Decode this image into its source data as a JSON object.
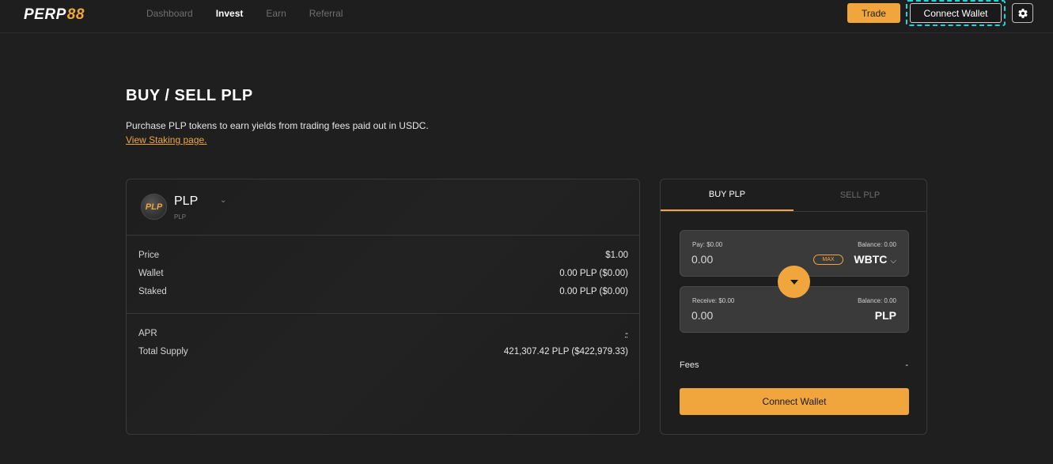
{
  "nav": {
    "logo_text": "PERP",
    "logo_num": "88",
    "links": [
      "Dashboard",
      "Invest",
      "Earn",
      "Referral"
    ],
    "active": "Invest",
    "trade_label": "Trade",
    "connect_label": "Connect Wallet",
    "settings_icon": "gear-icon"
  },
  "header": {
    "title": "BUY / SELL PLP",
    "description": "Purchase PLP tokens to earn yields from trading fees paid out in USDC.",
    "link_text": "View Staking page."
  },
  "token": {
    "logo_text": "PLP",
    "name": "PLP",
    "caret": "⌄",
    "subtitle": "PLP"
  },
  "stats": {
    "price_label": "Price",
    "price_value": "$1.00",
    "wallet_label": "Wallet",
    "wallet_value": "0.00 PLP ($0.00)",
    "staked_label": "Staked",
    "staked_value": "0.00 PLP ($0.00)",
    "apr_label": "APR",
    "apr_value": "-",
    "supply_label": "Total Supply",
    "supply_value": "421,307.42 PLP ($422,979.33)"
  },
  "trade_panel": {
    "tab_buy": "BUY PLP",
    "tab_sell": "SELL PLP",
    "pay_label": "Pay: $0.00",
    "pay_balance": "Balance: 0.00",
    "pay_amount": "0.00",
    "max_label": "MAX",
    "pay_token": "WBTC",
    "receive_label": "Receive: $0.00",
    "receive_balance": "Balance: 0.00",
    "receive_amount": "0.00",
    "receive_token": "PLP",
    "fees_label": "Fees",
    "fees_value": "-",
    "connect_label": "Connect Wallet"
  },
  "colors": {
    "accent": "#f0a63c",
    "background": "#1f1f1f",
    "highlight_outline": "#1fd3df"
  }
}
